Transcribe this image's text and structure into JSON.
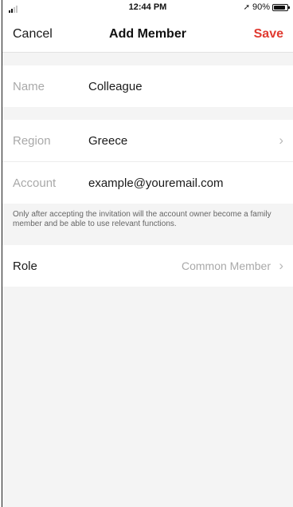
{
  "status_bar": {
    "time": "12:44 PM",
    "battery_text": "90%",
    "battery_level": 0.9,
    "signal_bars_active": 2,
    "signal_bars_total": 4
  },
  "nav": {
    "cancel_label": "Cancel",
    "title": "Add Member",
    "save_label": "Save"
  },
  "form": {
    "name": {
      "label": "Name",
      "value": "Colleague"
    },
    "region": {
      "label": "Region",
      "value": "Greece"
    },
    "account": {
      "label": "Account",
      "value": "example@youremail.com"
    },
    "note": "Only after accepting the invitation will the account owner become a family member and be able to use relevant functions.",
    "role": {
      "label": "Role",
      "value": "Common Member"
    }
  },
  "colors": {
    "accent": "#e03a30",
    "background": "#f4f4f4",
    "label_gray": "#a9a9a9"
  },
  "icons": {
    "chevron": "chevron-right-icon",
    "location": "location-arrow-icon",
    "battery": "battery-icon",
    "signal": "signal-icon"
  }
}
